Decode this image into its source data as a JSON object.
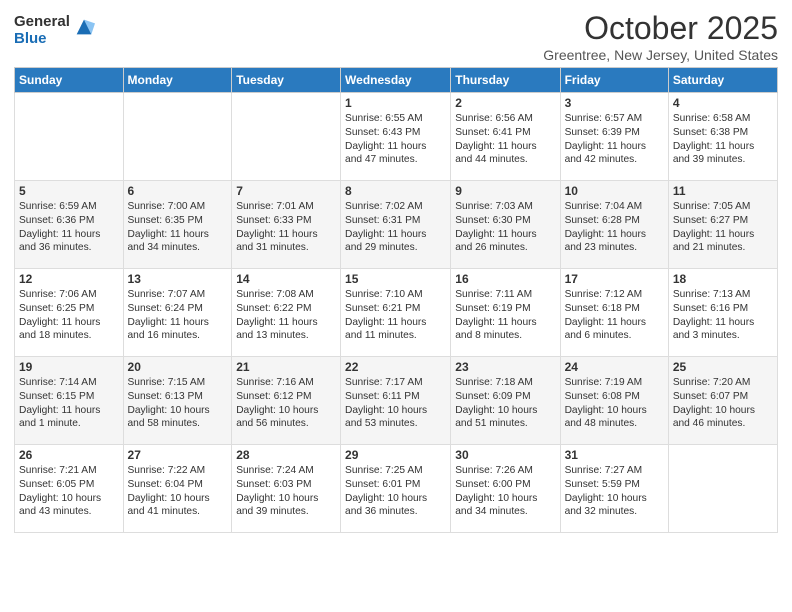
{
  "logo": {
    "general": "General",
    "blue": "Blue"
  },
  "title": "October 2025",
  "location": "Greentree, New Jersey, United States",
  "weekdays": [
    "Sunday",
    "Monday",
    "Tuesday",
    "Wednesday",
    "Thursday",
    "Friday",
    "Saturday"
  ],
  "weeks": [
    [
      {
        "day": "",
        "info": ""
      },
      {
        "day": "",
        "info": ""
      },
      {
        "day": "",
        "info": ""
      },
      {
        "day": "1",
        "info": "Sunrise: 6:55 AM\nSunset: 6:43 PM\nDaylight: 11 hours\nand 47 minutes."
      },
      {
        "day": "2",
        "info": "Sunrise: 6:56 AM\nSunset: 6:41 PM\nDaylight: 11 hours\nand 44 minutes."
      },
      {
        "day": "3",
        "info": "Sunrise: 6:57 AM\nSunset: 6:39 PM\nDaylight: 11 hours\nand 42 minutes."
      },
      {
        "day": "4",
        "info": "Sunrise: 6:58 AM\nSunset: 6:38 PM\nDaylight: 11 hours\nand 39 minutes."
      }
    ],
    [
      {
        "day": "5",
        "info": "Sunrise: 6:59 AM\nSunset: 6:36 PM\nDaylight: 11 hours\nand 36 minutes."
      },
      {
        "day": "6",
        "info": "Sunrise: 7:00 AM\nSunset: 6:35 PM\nDaylight: 11 hours\nand 34 minutes."
      },
      {
        "day": "7",
        "info": "Sunrise: 7:01 AM\nSunset: 6:33 PM\nDaylight: 11 hours\nand 31 minutes."
      },
      {
        "day": "8",
        "info": "Sunrise: 7:02 AM\nSunset: 6:31 PM\nDaylight: 11 hours\nand 29 minutes."
      },
      {
        "day": "9",
        "info": "Sunrise: 7:03 AM\nSunset: 6:30 PM\nDaylight: 11 hours\nand 26 minutes."
      },
      {
        "day": "10",
        "info": "Sunrise: 7:04 AM\nSunset: 6:28 PM\nDaylight: 11 hours\nand 23 minutes."
      },
      {
        "day": "11",
        "info": "Sunrise: 7:05 AM\nSunset: 6:27 PM\nDaylight: 11 hours\nand 21 minutes."
      }
    ],
    [
      {
        "day": "12",
        "info": "Sunrise: 7:06 AM\nSunset: 6:25 PM\nDaylight: 11 hours\nand 18 minutes."
      },
      {
        "day": "13",
        "info": "Sunrise: 7:07 AM\nSunset: 6:24 PM\nDaylight: 11 hours\nand 16 minutes."
      },
      {
        "day": "14",
        "info": "Sunrise: 7:08 AM\nSunset: 6:22 PM\nDaylight: 11 hours\nand 13 minutes."
      },
      {
        "day": "15",
        "info": "Sunrise: 7:10 AM\nSunset: 6:21 PM\nDaylight: 11 hours\nand 11 minutes."
      },
      {
        "day": "16",
        "info": "Sunrise: 7:11 AM\nSunset: 6:19 PM\nDaylight: 11 hours\nand 8 minutes."
      },
      {
        "day": "17",
        "info": "Sunrise: 7:12 AM\nSunset: 6:18 PM\nDaylight: 11 hours\nand 6 minutes."
      },
      {
        "day": "18",
        "info": "Sunrise: 7:13 AM\nSunset: 6:16 PM\nDaylight: 11 hours\nand 3 minutes."
      }
    ],
    [
      {
        "day": "19",
        "info": "Sunrise: 7:14 AM\nSunset: 6:15 PM\nDaylight: 11 hours\nand 1 minute."
      },
      {
        "day": "20",
        "info": "Sunrise: 7:15 AM\nSunset: 6:13 PM\nDaylight: 10 hours\nand 58 minutes."
      },
      {
        "day": "21",
        "info": "Sunrise: 7:16 AM\nSunset: 6:12 PM\nDaylight: 10 hours\nand 56 minutes."
      },
      {
        "day": "22",
        "info": "Sunrise: 7:17 AM\nSunset: 6:11 PM\nDaylight: 10 hours\nand 53 minutes."
      },
      {
        "day": "23",
        "info": "Sunrise: 7:18 AM\nSunset: 6:09 PM\nDaylight: 10 hours\nand 51 minutes."
      },
      {
        "day": "24",
        "info": "Sunrise: 7:19 AM\nSunset: 6:08 PM\nDaylight: 10 hours\nand 48 minutes."
      },
      {
        "day": "25",
        "info": "Sunrise: 7:20 AM\nSunset: 6:07 PM\nDaylight: 10 hours\nand 46 minutes."
      }
    ],
    [
      {
        "day": "26",
        "info": "Sunrise: 7:21 AM\nSunset: 6:05 PM\nDaylight: 10 hours\nand 43 minutes."
      },
      {
        "day": "27",
        "info": "Sunrise: 7:22 AM\nSunset: 6:04 PM\nDaylight: 10 hours\nand 41 minutes."
      },
      {
        "day": "28",
        "info": "Sunrise: 7:24 AM\nSunset: 6:03 PM\nDaylight: 10 hours\nand 39 minutes."
      },
      {
        "day": "29",
        "info": "Sunrise: 7:25 AM\nSunset: 6:01 PM\nDaylight: 10 hours\nand 36 minutes."
      },
      {
        "day": "30",
        "info": "Sunrise: 7:26 AM\nSunset: 6:00 PM\nDaylight: 10 hours\nand 34 minutes."
      },
      {
        "day": "31",
        "info": "Sunrise: 7:27 AM\nSunset: 5:59 PM\nDaylight: 10 hours\nand 32 minutes."
      },
      {
        "day": "",
        "info": ""
      }
    ]
  ]
}
